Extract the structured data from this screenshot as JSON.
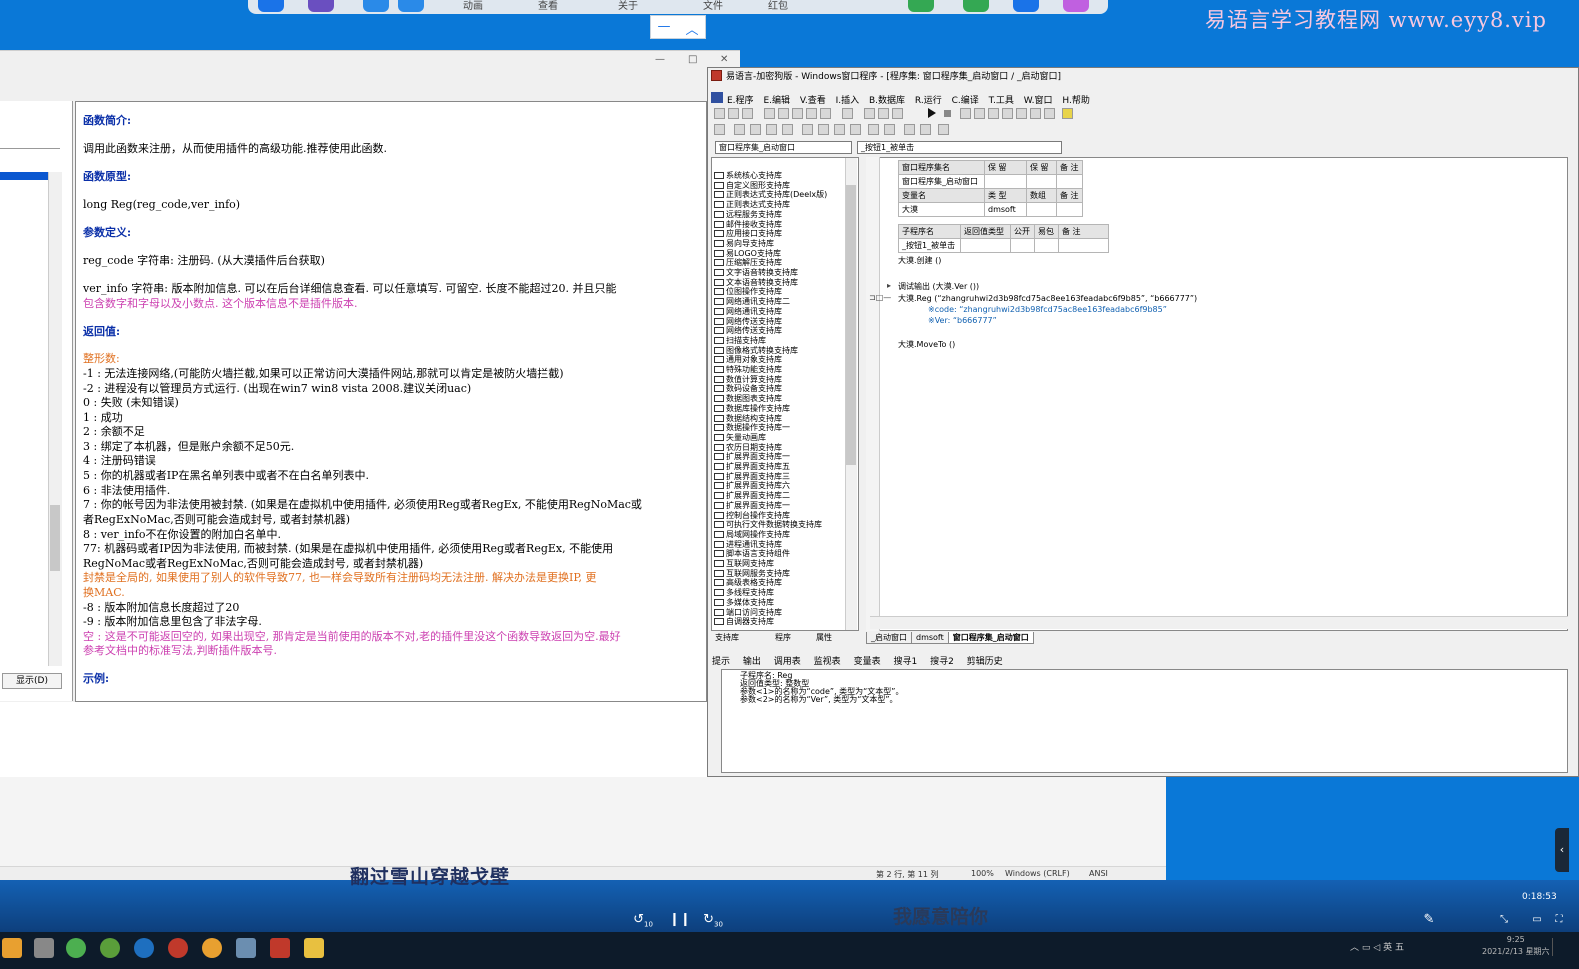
{
  "watermark": "易语言学习教程网 www.eyy8.vip",
  "topbar": {
    "items": [
      "动画",
      "查看",
      "关于",
      "文件",
      "红包"
    ]
  },
  "doc": {
    "show_button": "显示(D)",
    "lines": [
      {
        "t": "函数简介:",
        "c": "dh"
      },
      {
        "t": "调用此函数来注册，从而使用插件的高级功能.推荐使用此函数.",
        "c": ""
      },
      {
        "t": "函数原型:",
        "c": "dh"
      },
      {
        "t": "long Reg(reg_code,ver_info)",
        "c": ""
      },
      {
        "t": "参数定义:",
        "c": "dh"
      },
      {
        "t": "reg_code 字符串: 注册码. (从大漠插件后台获取)",
        "c": ""
      },
      {
        "t": "ver_info 字符串: 版本附加信息. 可以在后台详细信息查看. 可以任意填写. 可留空. 长度不能超过20. 并且只能",
        "c": ""
      },
      {
        "t": "包含数字和字母以及小数点. 这个版本信息不是插件版本.",
        "c": "pk"
      },
      {
        "t": "返回值:",
        "c": "dh"
      },
      {
        "t": "整形数:",
        "c": "or"
      },
      {
        "t": "-1 : 无法连接网络,(可能防火墙拦截,如果可以正常访问大漠插件网站,那就可以肯定是被防火墙拦截)",
        "c": ""
      },
      {
        "t": "-2 : 进程没有以管理员方式运行. (出现在win7 win8 vista 2008.建议关闭uac)",
        "c": ""
      },
      {
        "t": "0 : 失败 (未知错误)",
        "c": ""
      },
      {
        "t": "1 : 成功",
        "c": ""
      },
      {
        "t": "2 : 余额不足",
        "c": ""
      },
      {
        "t": "3 : 绑定了本机器，但是账户余额不足50元.",
        "c": ""
      },
      {
        "t": "4 : 注册码错误",
        "c": ""
      },
      {
        "t": "5 : 你的机器或者IP在黑名单列表中或者不在白名单列表中.",
        "c": ""
      },
      {
        "t": "6 : 非法使用插件.",
        "c": ""
      },
      {
        "t": "7 : 你的帐号因为非法使用被封禁. (如果是在虚拟机中使用插件, 必须使用Reg或者RegEx, 不能使用RegNoMac或",
        "c": ""
      },
      {
        "t": "者RegExNoMac,否则可能会造成封号, 或者封禁机器)",
        "c": ""
      },
      {
        "t": "8 : ver_info不在你设置的附加白名单中.",
        "c": ""
      },
      {
        "t": "77: 机器码或者IP因为非法使用, 而被封禁. (如果是在虚拟机中使用插件, 必须使用Reg或者RegEx, 不能使用",
        "c": ""
      },
      {
        "t": "RegNoMac或者RegExNoMac,否则可能会造成封号, 或者封禁机器)",
        "c": ""
      },
      {
        "t": "    封禁是全局的, 如果使用了别人的软件导致77, 也一样会导致所有注册码均无法注册. 解决办法是更换IP, 更",
        "c": "or"
      },
      {
        "t": "换MAC.",
        "c": "or"
      },
      {
        "t": "-8 : 版本附加信息长度超过了20",
        "c": ""
      },
      {
        "t": "-9 : 版本附加信息里包含了非法字母.",
        "c": ""
      },
      {
        "t": "空 : 这是不可能返回空的, 如果出现空, 那肯定是当前使用的版本不对,老的插件里没这个函数导致返回为空.最好",
        "c": "pk"
      },
      {
        "t": "参考文档中的标准写法,判断插件版本号.",
        "c": "pk"
      },
      {
        "t": "示例:",
        "c": "dh"
      }
    ]
  },
  "ide": {
    "title": "易语言-加密狗版 - Windows窗口程序 - [程序集: 窗口程序集_启动窗口 / _启动窗口]",
    "menu": [
      "E.程序",
      "E.编辑",
      "V.查看",
      "I.插入",
      "B.数据库",
      "R.运行",
      "C.编译",
      "T.工具",
      "W.窗口",
      "H.帮助"
    ],
    "combo_left": "窗口程序集_启动窗口",
    "combo_right": "_按钮1_被单击",
    "libraries": [
      "系统核心支持库",
      "自定义图形支持库",
      "正则表达式支持库(Deelx版)",
      "正则表达式支持库",
      "远程服务支持库",
      "邮件接收支持库",
      "应用接口支持库",
      "易向导支持库",
      "易LOGO支持库",
      "压缩解压支持库",
      "文字语音转换支持库",
      "文本语音转换支持库",
      "位图操作支持库",
      "网络通讯支持库二",
      "网络通讯支持库",
      "网络传送支持库",
      "网络传送支持库",
      "扫描支持库",
      "图像格式转换支持库",
      "通用对象支持库",
      "特殊功能支持库",
      "数值计算支持库",
      "数码设备支持库",
      "数据图表支持库",
      "数据库操作支持库",
      "数据结构支持库",
      "数据操作支持库一",
      "矢量动画库",
      "农历日期支持库",
      "扩展界面支持库一",
      "扩展界面支持库五",
      "扩展界面支持库三",
      "扩展界面支持库六",
      "扩展界面支持库二",
      "扩展界面支持库一",
      "控制台操作支持库",
      "可执行文件数据转换支持库",
      "局域网操作支持库",
      "进程通讯支持库",
      "脚本语言支持组件",
      "互联网支持库",
      "互联网服务支持库",
      "高级表格支持库",
      "多线程支持库",
      "多媒体支持库",
      "端口访问支持库",
      "自调器支持库"
    ],
    "lib_tabs": [
      "支持库",
      "程序",
      "属性"
    ],
    "assembly_table": {
      "header": [
        "窗口程序集名",
        "保 留",
        "保 留",
        "备 注"
      ],
      "row": [
        "窗口程序集_启动窗口",
        "",
        "",
        ""
      ]
    },
    "var_table": {
      "header": [
        "变量名",
        "类 型",
        "数组",
        "备 注"
      ],
      "row": [
        "大漠",
        "dmsoft",
        "",
        ""
      ]
    },
    "sub_table": {
      "header": [
        "子程序名",
        "返回值类型",
        "公开",
        "易包",
        "备 注"
      ],
      "row": [
        "_按钮1_被单击",
        "",
        "",
        "",
        ""
      ]
    },
    "code_lines": [
      "大漠.创建 ()",
      "调试输出 (大漠.Ver ())",
      "大漠.Reg (“zhangruhwi2d3b98fcd75ac8ee163feadabc6f9b85”, “b666777”)",
      "※code:  “zhangruhwi2d3b98fcd75ac8ee163feadabc6f9b85”",
      "※Ver:  “b666777”",
      "大漠.MoveTo ()"
    ],
    "code_tabs": [
      "_启动窗口",
      "dmsoft",
      "窗口程序集_启动窗口"
    ],
    "output_tabs": [
      "提示",
      "输出",
      "调用表",
      "监视表",
      "变量表",
      "搜寻1",
      "搜寻2",
      "剪辑历史"
    ],
    "output_lines": [
      "子程序名: Reg",
      "返回值类型: 整数型",
      "参数<1>的名称为“code”, 类型为“文本型”。",
      "参数<2>的名称为“Ver”, 类型为“文本型”。"
    ]
  },
  "status": {
    "position": "第 2 行, 第 11 列",
    "zoom": "100%",
    "line_ending": "Windows (CRLF)",
    "encoding": "ANSI"
  },
  "player": {
    "subtitle_top": "翻过雪山穿越戈壁",
    "subtitle_bottom": "我愿意陪你",
    "timecode": "0:18:53",
    "rewind_label": "10",
    "forward_label": "30"
  },
  "taskbar": {
    "time": "9:25",
    "date": "2021/2/13 星期六",
    "ime": "英",
    "ime_box": "五"
  }
}
